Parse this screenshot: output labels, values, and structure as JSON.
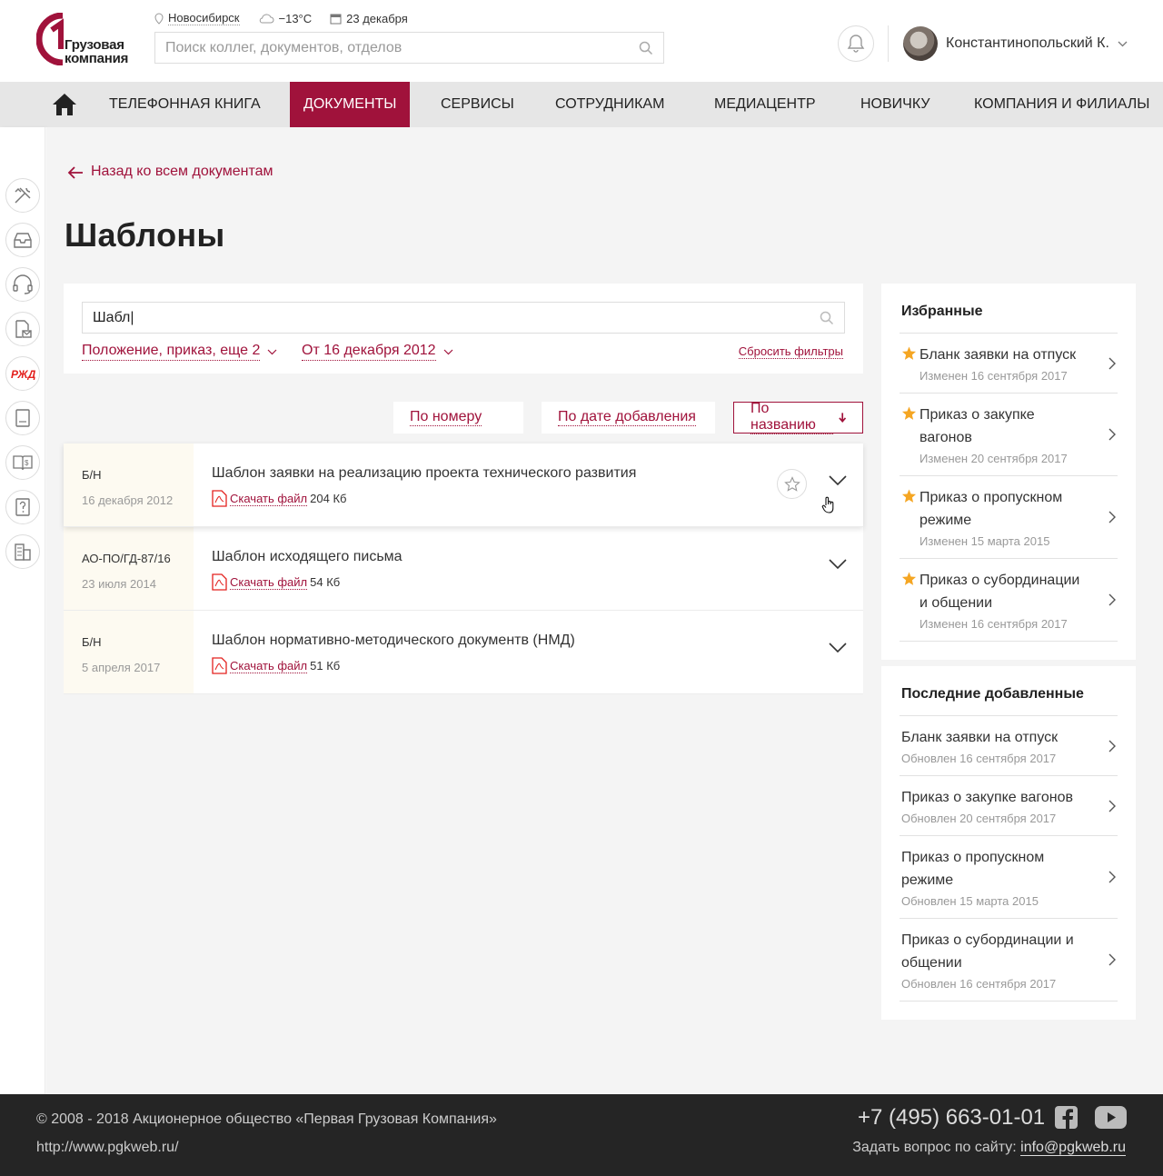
{
  "brand": {
    "line1": "Грузовая",
    "line2": "компания",
    "accent": "#a0123b"
  },
  "header": {
    "city": "Новосибирск",
    "weather": "−13°C",
    "date": "23 декабря",
    "search_placeholder": "Поиск коллег, документов, отделов",
    "user_name": "Константинопольский К."
  },
  "nav": {
    "items": [
      {
        "label": "Телефонная книга"
      },
      {
        "label": "Документы"
      },
      {
        "label": "Сервисы"
      },
      {
        "label": "Сотрудникам"
      },
      {
        "label": "Медиацентр"
      },
      {
        "label": "Новичку"
      },
      {
        "label": "Компания и филиалы"
      }
    ],
    "active": "Документы"
  },
  "rail": {
    "icons": [
      "tools-icon",
      "inbox-icon",
      "headset-icon",
      "document-mail-icon",
      "rzd-logo-icon",
      "book-icon",
      "money-book-icon",
      "question-doc-icon",
      "building-icon"
    ],
    "rzd_label": "РЖД"
  },
  "page": {
    "back_label": "Назад ко всем документам",
    "title": "Шаблоны"
  },
  "filter": {
    "query": "Шабл|",
    "type_filter": "Положение, приказ, еще 2",
    "date_filter": "От 16 декабря 2012",
    "reset": "Сбросить фильтры"
  },
  "sort": {
    "by_number": "По номеру",
    "by_date": "По дате добавления",
    "by_name": "По названию",
    "active": "По названию"
  },
  "documents": [
    {
      "number": "Б/Н",
      "date": "16 декабря 2012",
      "title": "Шаблон заявки на реализацию проекта технического развития",
      "download": "Скачать файл",
      "size": "204 Кб"
    },
    {
      "number": "АО-ПО/ГД-87/16",
      "date": "23 июля 2014",
      "title": "Шаблон исходящего письма",
      "download": "Скачать файл",
      "size": "54 Кб"
    },
    {
      "number": "Б/Н",
      "date": "5 апреля 2017",
      "title": "Шаблон нормативно-методического документв (НМД)",
      "download": "Скачать файл",
      "size": "51 Кб"
    }
  ],
  "favorites": {
    "title": "Избранные",
    "items": [
      {
        "title": "Бланк заявки на отпуск",
        "date": "Изменен 16 сентября 2017"
      },
      {
        "title": "Приказ о закупке вагонов",
        "date": "Изменен 20 сентября 2017"
      },
      {
        "title": "Приказ о пропускном режиме",
        "date": "Изменен 15 марта 2015"
      },
      {
        "title": "Приказ о субординации и общении",
        "date": "Изменен 16 сентября 2017"
      }
    ]
  },
  "recent": {
    "title": "Последние добавленные",
    "items": [
      {
        "title": "Бланк заявки на отпуск",
        "date": "Обновлен 16 сентября 2017"
      },
      {
        "title": "Приказ о закупке вагонов",
        "date": "Обновлен 20 сентября 2017"
      },
      {
        "title": "Приказ о пропускном режиме",
        "date": "Обновлен 15 марта 2015"
      },
      {
        "title": "Приказ о субординации и общении",
        "date": "Обновлен 16 сентября 2017"
      }
    ]
  },
  "footer": {
    "copyright": "© 2008 - 2018 Акционерное общество «Первая Грузовая Компания»",
    "site": "http://www.pgkweb.ru/",
    "phone": "+7 (495) 663-01-01",
    "ask_label": "Задать вопрос по сайту:",
    "email": "info@pgkweb.ru"
  }
}
